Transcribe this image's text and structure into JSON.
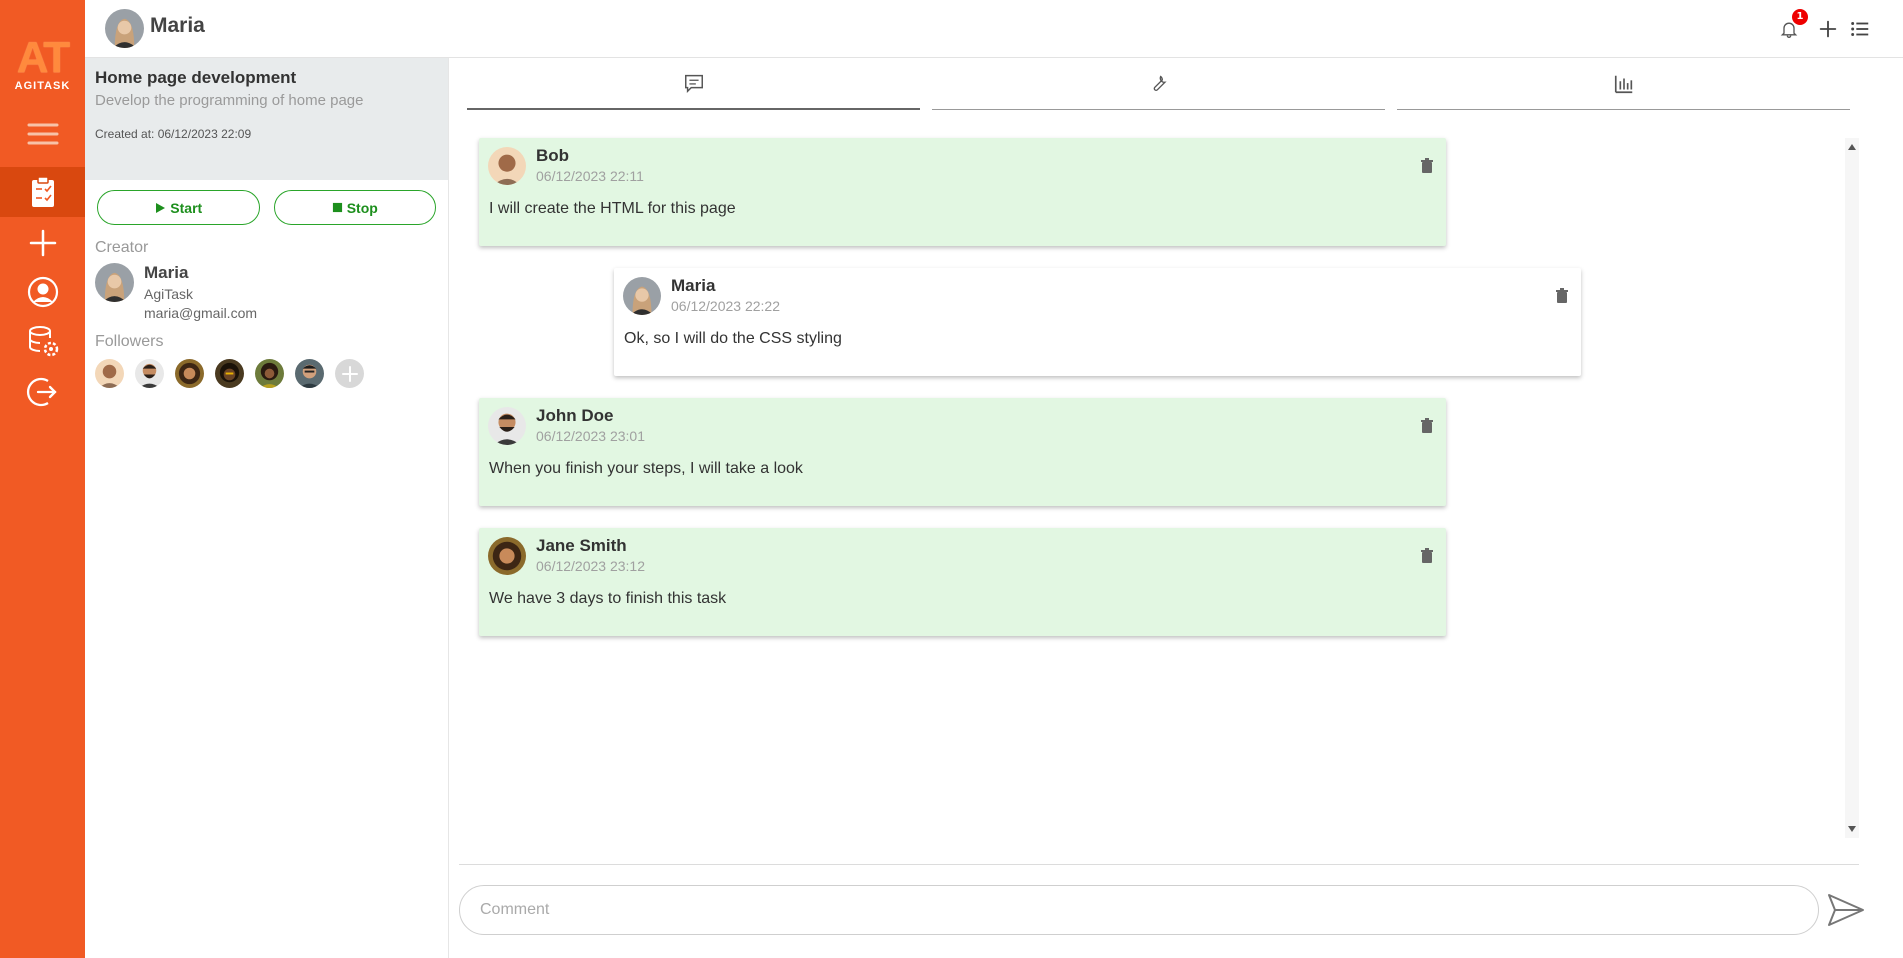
{
  "brand": {
    "logo_mark": "AT",
    "logo_word": "AGITASK",
    "accent": "#f15a24"
  },
  "rail": {
    "items": [
      {
        "name": "menu-icon"
      },
      {
        "name": "tasks-icon",
        "active": true
      },
      {
        "name": "add-icon"
      },
      {
        "name": "profile-icon"
      },
      {
        "name": "database-settings-icon"
      },
      {
        "name": "logout-icon"
      }
    ]
  },
  "header": {
    "user_name": "Maria",
    "notification_count": "1",
    "icons": [
      "bell-icon",
      "plus-icon",
      "list-icon"
    ]
  },
  "task": {
    "title": "Home page development",
    "description": "Develop the programming of home page",
    "created": "Created at: 06/12/2023 22:09",
    "start_label": "Start",
    "stop_label": "Stop"
  },
  "creator": {
    "section_label": "Creator",
    "name": "Maria",
    "org": "AgiTask",
    "email": "maria@gmail.com"
  },
  "followers": {
    "section_label": "Followers",
    "count": 6
  },
  "tabs": [
    "comments-tab-icon",
    "tools-tab-icon",
    "stats-tab-icon"
  ],
  "comments": [
    {
      "author": "Bob",
      "time": "06/12/2023 22:11",
      "text": "I will create the HTML for this page",
      "own": false
    },
    {
      "author": "Maria",
      "time": "06/12/2023 22:22",
      "text": "Ok, so I will do the CSS styling",
      "own": true
    },
    {
      "author": "John Doe",
      "time": "06/12/2023 23:01",
      "text": "When you finish your steps, I will take a look",
      "own": false
    },
    {
      "author": "Jane Smith",
      "time": "06/12/2023 23:12",
      "text": "We have 3 days to finish this task",
      "own": false
    }
  ],
  "composer": {
    "placeholder": "Comment"
  },
  "colors": {
    "start_green": "#2aa52a",
    "comment_bg": "#e2f7e2",
    "badge_red": "#ee0000"
  }
}
